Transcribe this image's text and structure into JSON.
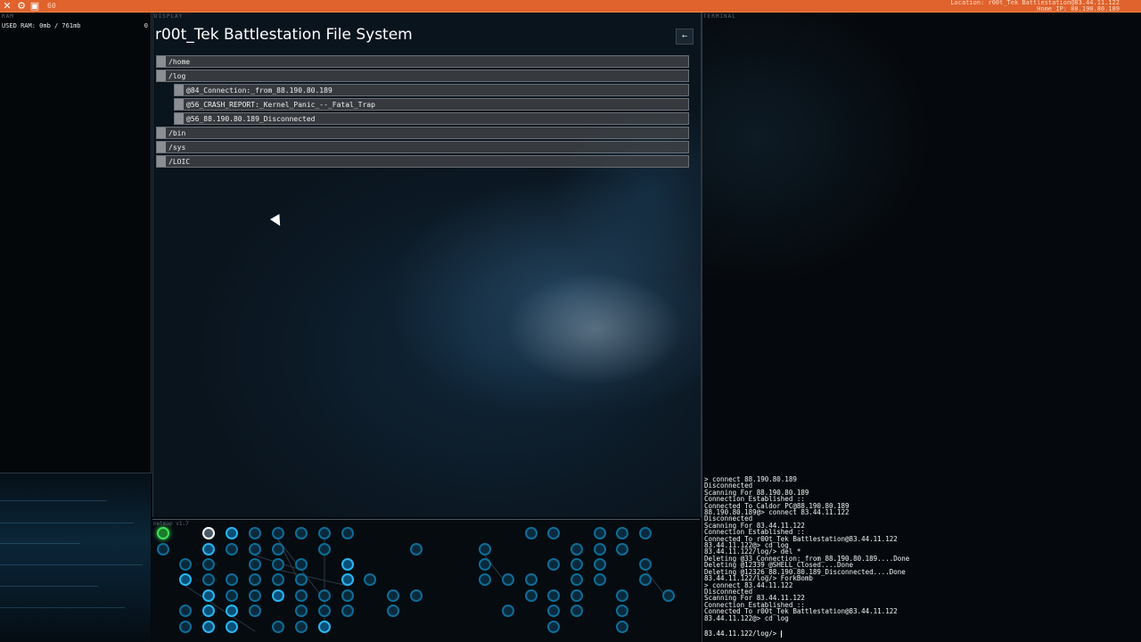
{
  "topbar": {
    "icons": [
      "close-icon",
      "gear-icon",
      "save-icon"
    ],
    "fps": "60",
    "location": "Location: r00t_Tek Battlestation@83.44.11.122",
    "home_ip": "Home IP: 88.190.80.189"
  },
  "ram": {
    "label": "RAM",
    "used": "USED RAM: 0mb / 761mb",
    "count": "0"
  },
  "display": {
    "label": "DISPLAY",
    "title": "r00t_Tek Battlestation File System",
    "back_icon": "←",
    "rows": [
      {
        "label": "/home"
      },
      {
        "label": "/log"
      },
      {
        "label": "@84_Connection:_from_88.190.80.189"
      },
      {
        "label": "@56_CRASH_REPORT:_Kernel_Panic_--_Fatal_Trap"
      },
      {
        "label": "@56_88.190.80.189_Disconnected"
      },
      {
        "label": "/bin"
      },
      {
        "label": "/sys"
      },
      {
        "label": "/LOIC"
      }
    ]
  },
  "netmap": {
    "label": "netmap v1.7"
  },
  "terminal": {
    "label": "TERMINAL",
    "lines": [
      "> connect 88.190.80.189",
      "Disconnected",
      "Scanning For 88.190.80.189",
      "Connection Established ::",
      "Connected To Caldor PC@88.190.80.189",
      "88.190.80.189@> connect 83.44.11.122",
      "Disconnected",
      "Scanning For 83.44.11.122",
      "Connection Established ::",
      "Connected To r00t_Tek Battlestation@83.44.11.122",
      "83.44.11.122@> cd log",
      "83.44.11.122/log/> del *",
      "Deleting @33_Connection:_from_88.190.80.189....Done",
      "Deleting @12339_@SHELL_Closed....Done",
      "Deleting @12326_88.190.80.189_Disconnected....Done",
      "83.44.11.122/log/> ForkBomb",
      "> connect 83.44.11.122",
      "Disconnected",
      "Scanning For 83.44.11.122",
      "Connection Established ::",
      "Connected To r00t_Tek Battlestation@83.44.11.122",
      "83.44.11.122@> cd log"
    ],
    "prompt": "83.44.11.122/log/> "
  },
  "colors": {
    "topbar": "#e0622c",
    "node": "#29b6f0",
    "home_node": "#3fe05a"
  }
}
